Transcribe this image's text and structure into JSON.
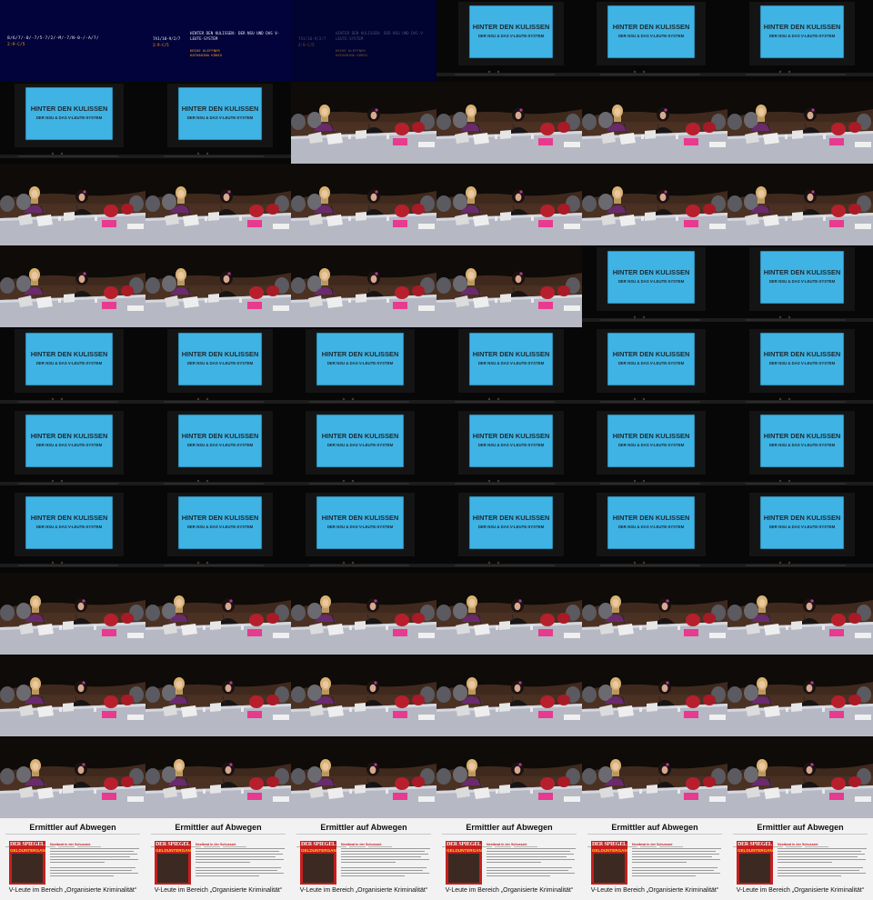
{
  "thumbnails": {
    "rows": 11,
    "cols": 6,
    "kinds": [
      [
        "title",
        "title",
        "title-dim",
        "slide",
        "slide",
        "slide"
      ],
      [
        "slide",
        "slide",
        "panel",
        "panel",
        "panel",
        "panel"
      ],
      [
        "panel",
        "panel",
        "panel",
        "panel",
        "panel",
        "panel"
      ],
      [
        "panel",
        "panel",
        "panel",
        "panel",
        "slide",
        "slide"
      ],
      [
        "slide",
        "slide",
        "slide",
        "slide",
        "slide",
        "slide"
      ],
      [
        "slide",
        "slide",
        "slide",
        "slide",
        "slide",
        "slide"
      ],
      [
        "slide",
        "slide",
        "slide",
        "slide",
        "slide",
        "slide"
      ],
      [
        "panel",
        "panel",
        "panel",
        "panel",
        "panel",
        "panel"
      ],
      [
        "panel",
        "panel",
        "panel",
        "panel",
        "panel",
        "panel"
      ],
      [
        "panel",
        "panel",
        "panel",
        "panel",
        "panel",
        "panel"
      ],
      [
        "document",
        "document",
        "document",
        "document",
        "document",
        "document"
      ]
    ]
  },
  "title_card": {
    "code": "8/6/7/-0/-7/5-7/2/-M/-7/N-0-/-A/7/",
    "time": "2:9-C/5",
    "event_code": "7A1/10-9/2/7",
    "event_time": "2:9-C/5",
    "talk_title": "HINTER DEN KULISSEN: DER NSU UND DAS V-LEUTE-SYSTEM",
    "speakers": [
      "HEIKE KLEFFNER",
      "KATHARINA KÖNIG"
    ]
  },
  "slide": {
    "title": "HINTER DEN KULISSEN",
    "subtitle": "DER NSU & DAS V-LEUTE-SYSTEM"
  },
  "document": {
    "title": "Ermittler auf Abwegen",
    "magazine_mast": "DER SPIEGEL",
    "magazine_headline": "GELDUNTERGANG",
    "article_heading": "Nestbeat in der Schusszie",
    "caption": "V-Leute im Bereich „Organisierte Kriminalität“"
  },
  "colors": {
    "title_bg": "#01033a",
    "slide_blue": "#3fb3e4",
    "table_gray": "#b6b8c4",
    "accent_red": "#c41f1f",
    "laptop": "#dcdcdc"
  }
}
